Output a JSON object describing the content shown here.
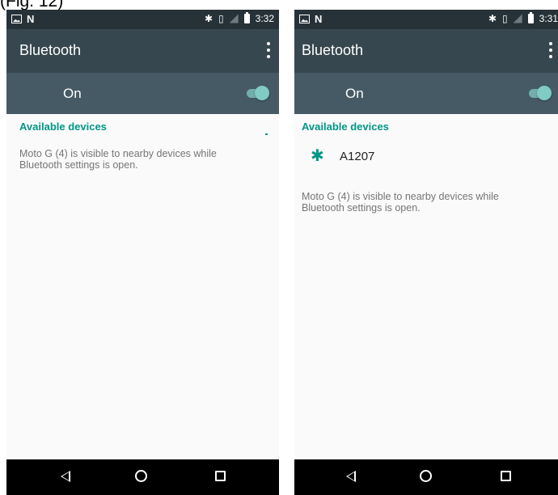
{
  "caption": "(Fig. 12)",
  "colors": {
    "status_bar": "#263238",
    "app_bar": "#37474f",
    "on_bar": "#455a64",
    "accent": "#009688",
    "toggle": "#80cbc4",
    "nav_bar": "#000000"
  },
  "left": {
    "status": {
      "time": "3:32",
      "icons": [
        "image-icon",
        "n-icon",
        "bluetooth-icon",
        "vibrate-icon",
        "signal-icon",
        "battery-icon"
      ]
    },
    "app_bar": {
      "title": "Bluetooth",
      "menu_icon": "more-vert-icon"
    },
    "switch": {
      "label": "On",
      "state": "on"
    },
    "section_header": "Available devices",
    "devices": [],
    "info": "Moto G (4) is visible to nearby devices while Bluetooth settings is open.",
    "nav": [
      "back-icon",
      "home-icon",
      "recents-icon"
    ]
  },
  "right": {
    "status": {
      "time": "3:31",
      "icons": [
        "image-icon",
        "n-icon",
        "bluetooth-icon",
        "vibrate-icon",
        "signal-icon",
        "battery-icon"
      ]
    },
    "app_bar": {
      "title": "Bluetooth",
      "menu_icon": "more-vert-icon"
    },
    "switch": {
      "label": "On",
      "state": "on"
    },
    "section_header": "Available devices",
    "devices": [
      {
        "name": "A1207",
        "icon": "bluetooth-icon"
      }
    ],
    "info": "Moto G (4) is visible to nearby devices while Bluetooth settings is open.",
    "nav": [
      "back-icon",
      "home-icon",
      "recents-icon"
    ]
  }
}
